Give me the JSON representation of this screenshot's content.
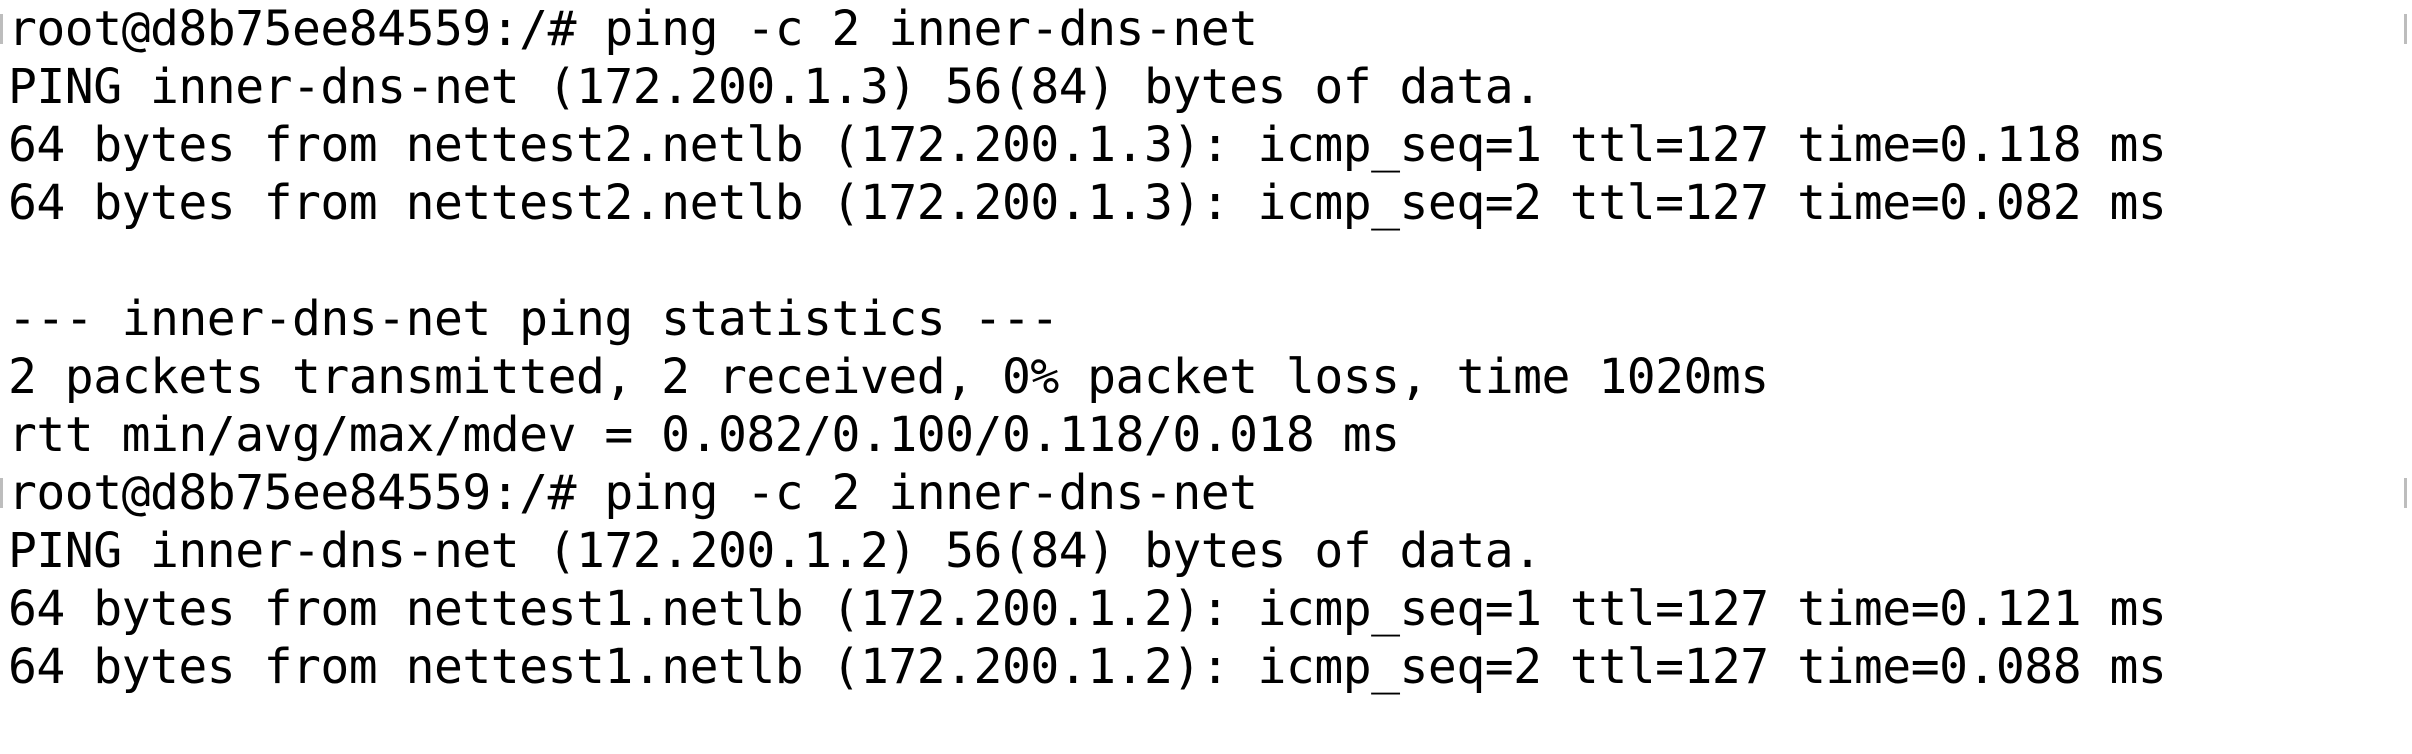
{
  "terminal": {
    "lines": [
      "root@d8b75ee84559:/# ping -c 2 inner-dns-net",
      "PING inner-dns-net (172.200.1.3) 56(84) bytes of data.",
      "64 bytes from nettest2.netlb (172.200.1.3): icmp_seq=1 ttl=127 time=0.118 ms",
      "64 bytes from nettest2.netlb (172.200.1.3): icmp_seq=2 ttl=127 time=0.082 ms",
      "",
      "--- inner-dns-net ping statistics ---",
      "2 packets transmitted, 2 received, 0% packet loss, time 1020ms",
      "rtt min/avg/max/mdev = 0.082/0.100/0.118/0.018 ms",
      "root@d8b75ee84559:/# ping -c 2 inner-dns-net",
      "PING inner-dns-net (172.200.1.2) 56(84) bytes of data.",
      "64 bytes from nettest1.netlb (172.200.1.2): icmp_seq=1 ttl=127 time=0.121 ms",
      "64 bytes from nettest1.netlb (172.200.1.2): icmp_seq=2 ttl=127 time=0.088 ms",
      ""
    ]
  }
}
